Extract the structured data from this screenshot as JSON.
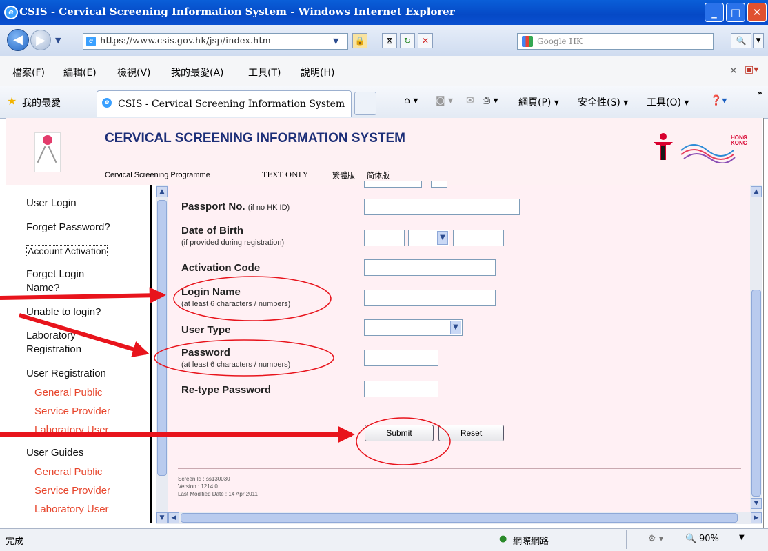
{
  "window": {
    "title": "CSIS - Cervical Screening Information System - Windows Internet Explorer",
    "buttons": {
      "minimize": "_",
      "maximize": "□",
      "close": "✕"
    }
  },
  "addressbar": {
    "url": "https://www.csis.gov.hk/jsp/index.htm",
    "search_engine": "Google HK"
  },
  "menubar": {
    "items": [
      "檔案(F)",
      "編輯(E)",
      "檢視(V)",
      "我的最愛(A)",
      "工具(T)",
      "說明(H)"
    ]
  },
  "favbar": {
    "favorites_label": "我的最愛",
    "tab_title": "CSIS - Cervical Screening Information System",
    "commands": [
      "網頁(P) ▾",
      "安全性(S) ▾",
      "工具(O) ▾"
    ]
  },
  "header": {
    "title": "CERVICAL SCREENING INFORMATION SYSTEM",
    "links": [
      "Cervical Screening Programme",
      "TEXT ONLY",
      "繁體版",
      "简体版"
    ],
    "logo_text": "HONG KONG"
  },
  "sidebar": {
    "items": [
      {
        "label": "User Login"
      },
      {
        "label": "Forget Password?"
      },
      {
        "label": "Account Activation"
      },
      {
        "label": "Forget Login"
      },
      {
        "label": "Name?"
      },
      {
        "label": "Unable to login?"
      },
      {
        "label": "Laboratory"
      },
      {
        "label": "Registration"
      },
      {
        "label": "User Registration"
      },
      {
        "label": "General Public"
      },
      {
        "label": "Service Provider"
      },
      {
        "label": "Laboratory User"
      },
      {
        "label": "User Guides"
      },
      {
        "label": "General Public"
      },
      {
        "label": "Service Provider"
      },
      {
        "label": "Laboratory User"
      }
    ]
  },
  "form": {
    "passport_label": "Passport No.",
    "passport_hint": "(if no HK ID)",
    "dob_label": "Date of Birth",
    "dob_hint": "(if provided during registration)",
    "activation_label": "Activation Code",
    "login_label": "Login Name",
    "login_hint": "(at least 6 characters / numbers)",
    "usertype_label": "User Type",
    "password_label": "Password",
    "password_hint": "(at least 6 characters / numbers)",
    "retype_label": "Re-type Password",
    "submit": "Submit",
    "reset": "Reset"
  },
  "footer": {
    "screen_id": "Screen Id : ss130030",
    "version": "Version : 1214.0",
    "modified": "Last Modified Date : 14 Apr 2011"
  },
  "statusbar": {
    "status": "完成",
    "zone": "網際網路",
    "zoom": "90%"
  },
  "colors": {
    "annotation_red": "#e8141c",
    "title_blue": "#1d2f78",
    "link_orange": "#e7462d",
    "content_pink": "#fff0f4"
  }
}
